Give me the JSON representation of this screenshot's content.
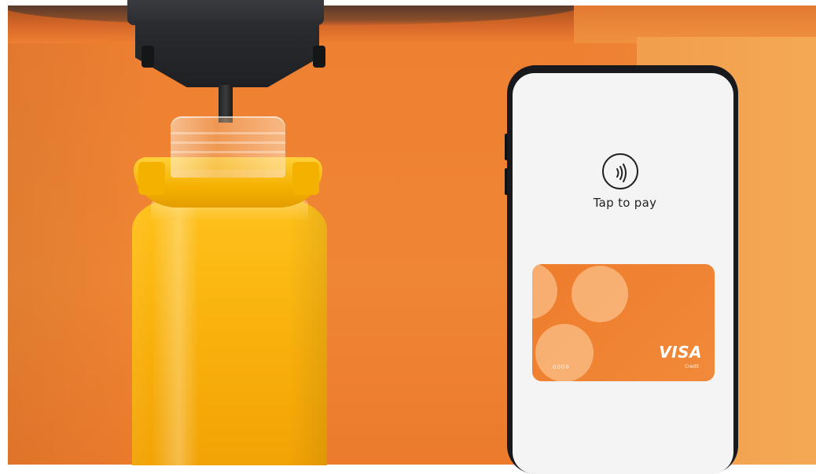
{
  "phone": {
    "nfc_icon": "contactless-icon",
    "tap_label": "Tap to pay"
  },
  "card": {
    "brand": "VISA",
    "type": "Credit",
    "digits": "0000",
    "color": "#ee7c2b"
  },
  "scene": {
    "background_color": "#ef8634",
    "juice_color": "#f9b10d",
    "collar_color": "#ffd13a"
  }
}
